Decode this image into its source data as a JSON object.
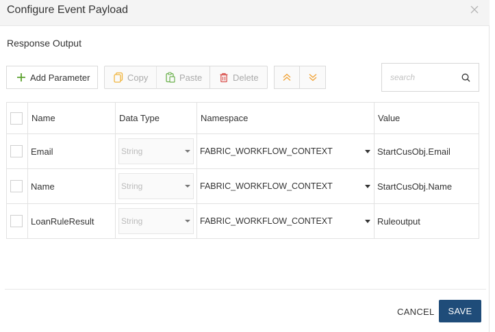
{
  "dialog": {
    "title": "Configure Event Payload",
    "close_icon": "close-icon"
  },
  "section": {
    "label": "Response Output"
  },
  "toolbar": {
    "add_label": "Add Parameter",
    "copy_label": "Copy",
    "paste_label": "Paste",
    "delete_label": "Delete",
    "icons": {
      "add": "plus-icon",
      "copy": "copy-icon",
      "paste": "paste-icon",
      "delete": "trash-icon",
      "up": "double-chevron-up-icon",
      "down": "double-chevron-down-icon"
    },
    "colors": {
      "add": "#5aa02c",
      "copy": "#f0b43c",
      "paste": "#6ab04c",
      "delete": "#d9534f",
      "move": "#f0a030"
    }
  },
  "search": {
    "placeholder": "search",
    "icon": "search-icon"
  },
  "table": {
    "headers": {
      "name": "Name",
      "data_type": "Data Type",
      "namespace": "Namespace",
      "value": "Value"
    },
    "rows": [
      {
        "name": "Email",
        "data_type": "String",
        "namespace": "FABRIC_WORKFLOW_CONTEXT",
        "value": "StartCusObj.Email"
      },
      {
        "name": "Name",
        "data_type": "String",
        "namespace": "FABRIC_WORKFLOW_CONTEXT",
        "value": "StartCusObj.Name"
      },
      {
        "name": "LoanRuleResult",
        "data_type": "String",
        "namespace": "FABRIC_WORKFLOW_CONTEXT",
        "value": "Ruleoutput"
      }
    ]
  },
  "footer": {
    "cancel_label": "CANCEL",
    "save_label": "SAVE"
  },
  "colors": {
    "primary": "#1f4c79",
    "header_bg": "#f4f4f4"
  }
}
